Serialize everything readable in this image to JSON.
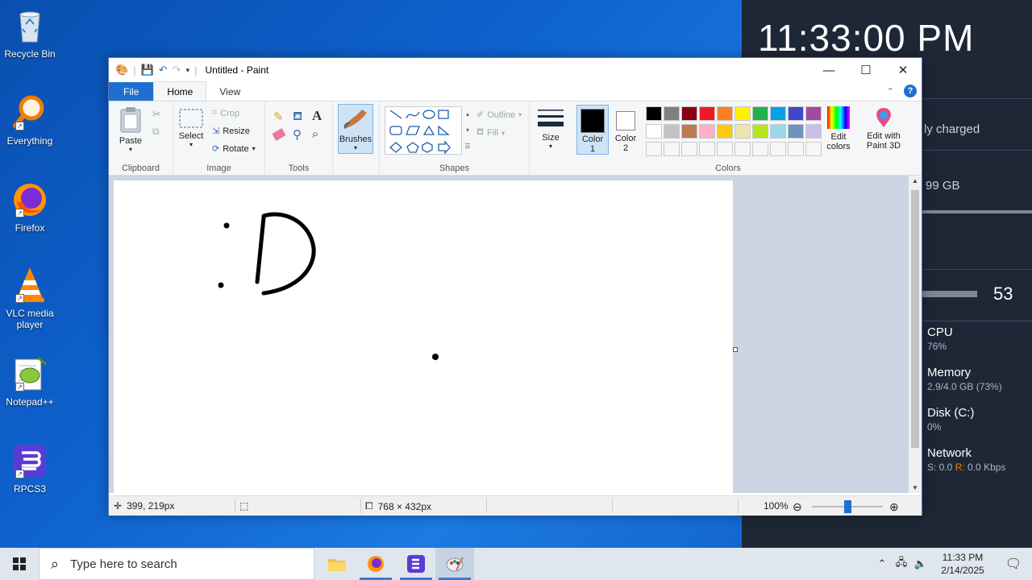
{
  "desktop": {
    "icons": [
      {
        "label": "Recycle Bin",
        "icon": "recycle-bin-icon"
      },
      {
        "label": "Everything",
        "icon": "everything-search-icon"
      },
      {
        "label": "Firefox",
        "icon": "firefox-icon"
      },
      {
        "label": "VLC media player",
        "icon": "vlc-icon"
      },
      {
        "label": "Notepad++",
        "icon": "notepadpp-icon"
      },
      {
        "label": "RPCS3",
        "icon": "rpcs3-icon"
      }
    ]
  },
  "widget": {
    "clock": "11:33:00 PM",
    "battery_text": "ly charged",
    "storage_text": "99 GB",
    "volume_value": "53",
    "cpu": {
      "title": "CPU",
      "value": "76%"
    },
    "memory": {
      "title": "Memory",
      "value": "2.9/4.0 GB (73%)"
    },
    "disk": {
      "title": "Disk (C:)",
      "value": "0%"
    },
    "network": {
      "title": "Network",
      "value_s": "S: 0.0",
      "value_r": "R:",
      "value_r2": "0.0 Kbps"
    }
  },
  "paint": {
    "title": "Untitled - Paint",
    "tabs": {
      "file": "File",
      "home": "Home",
      "view": "View"
    },
    "clipboard": {
      "paste": "Paste",
      "label": "Clipboard"
    },
    "image": {
      "select": "Select",
      "crop": "Crop",
      "resize": "Resize",
      "rotate": "Rotate",
      "label": "Image"
    },
    "tools": {
      "label": "Tools"
    },
    "brushes": {
      "label": "Brushes"
    },
    "shapes": {
      "outline": "Outline",
      "fill": "Fill",
      "label": "Shapes"
    },
    "size": {
      "label": "Size"
    },
    "color1": {
      "label": "Color",
      "sub": "1"
    },
    "color2": {
      "label": "Color",
      "sub": "2"
    },
    "edit_colors": {
      "label1": "Edit",
      "label2": "colors"
    },
    "edit_3d": {
      "label1": "Edit with",
      "label2": "Paint 3D"
    },
    "colors_label": "Colors",
    "palette_row1": [
      "#000000",
      "#7f7f7f",
      "#880015",
      "#ed1c24",
      "#ff7f27",
      "#fff200",
      "#22b14c",
      "#00a2e8",
      "#3f48cc",
      "#a349a4"
    ],
    "palette_row2": [
      "#ffffff",
      "#c3c3c3",
      "#b97a57",
      "#ffaec9",
      "#ffc90e",
      "#efe4b0",
      "#b5e61d",
      "#99d9ea",
      "#7092be",
      "#c8bfe7"
    ],
    "status": {
      "cursor_pos": "399, 219px",
      "canvas_size": "768 × 432px",
      "zoom": "100%"
    },
    "zoom_fraction": 0.5
  },
  "taskbar": {
    "search_placeholder": "Type here to search",
    "time": "11:33 PM",
    "date": "2/14/2025"
  }
}
